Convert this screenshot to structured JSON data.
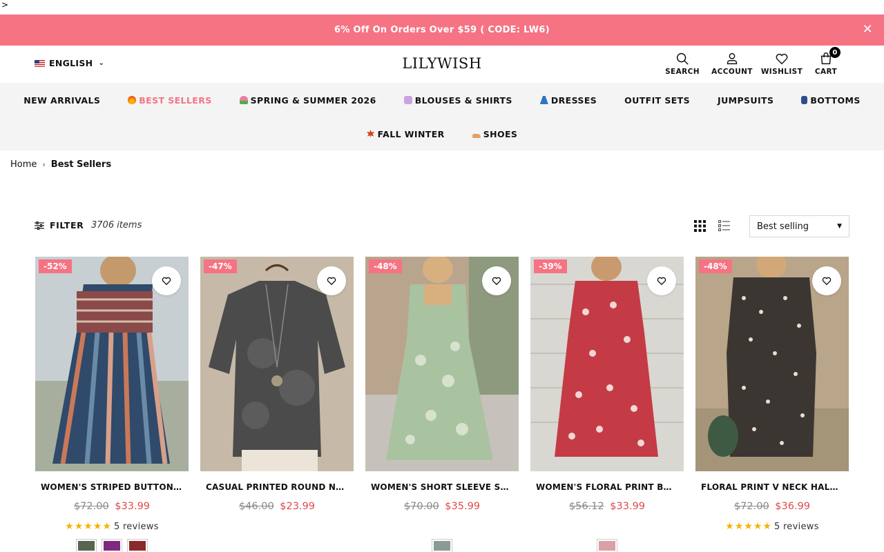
{
  "stray_char": ">",
  "promo": {
    "text": "6% Off On Orders Over $59 ( CODE: LW6)",
    "close": "✕",
    "bg": "#f57383"
  },
  "header": {
    "language": "ENGLISH",
    "logo": "LILYWISH",
    "icons": [
      {
        "label": "SEARCH",
        "icon": "search-icon"
      },
      {
        "label": "ACCOUNT",
        "icon": "user-icon"
      },
      {
        "label": "WISHLIST",
        "icon": "heart-icon"
      },
      {
        "label": "CART",
        "icon": "bag-icon",
        "count": "0"
      }
    ]
  },
  "nav": {
    "row1": [
      {
        "label": "NEW ARRIVALS",
        "icon": ""
      },
      {
        "label": "BEST SELLERS",
        "icon": "fire-icon",
        "active": true
      },
      {
        "label": "SPRING & SUMMER 2026",
        "icon": "tulip-icon"
      },
      {
        "label": "BLOUSES & SHIRTS",
        "icon": "tshirt-icon"
      },
      {
        "label": "DRESSES",
        "icon": "dress-icon"
      },
      {
        "label": "OUTFIT SETS",
        "icon": ""
      },
      {
        "label": "JUMPSUITS",
        "icon": ""
      },
      {
        "label": "BOTTOMS",
        "icon": "jeans-icon"
      }
    ],
    "row2": [
      {
        "label": "FALL WINTER",
        "icon": "maple-leaf-icon"
      },
      {
        "label": "SHOES",
        "icon": "shoe-icon"
      }
    ]
  },
  "breadcrumb": {
    "home": "Home",
    "separator": "›",
    "current": "Best Sellers"
  },
  "toolbar": {
    "filter_label": "FILTER",
    "item_count": "3706 items",
    "sort_value": "Best selling"
  },
  "products": [
    {
      "discount": "-52%",
      "title": "WOMEN'S STRIPED BUTTON FRONT MIDI DRESS",
      "old_price": "$72.00",
      "price": "$33.99",
      "stars": "★★★★★",
      "reviews": "5 reviews",
      "swatches": [
        "#55664f",
        "#7d2a7f",
        "#8a2a2a"
      ]
    },
    {
      "discount": "-47%",
      "title": "CASUAL PRINTED ROUND NECK TOP",
      "old_price": "$46.00",
      "price": "$23.99",
      "stars": "",
      "reviews": "",
      "swatches": []
    },
    {
      "discount": "-48%",
      "title": "WOMEN'S SHORT SLEEVE SQUARE NECK DRESS",
      "old_price": "$70.00",
      "price": "$35.99",
      "stars": "",
      "reviews": "",
      "swatches": [
        "#8a9a96"
      ]
    },
    {
      "discount": "-39%",
      "title": "WOMEN'S FLORAL PRINT BUTTON DRESS",
      "old_price": "$56.12",
      "price": "$33.99",
      "stars": "",
      "reviews": "",
      "swatches": [
        "#d9a0a6"
      ]
    },
    {
      "discount": "-48%",
      "title": "FLORAL PRINT V NECK HALF SLEEVE DRESS",
      "old_price": "$72.00",
      "price": "$36.99",
      "stars": "★★★★★",
      "reviews": "5 reviews",
      "swatches": []
    }
  ]
}
